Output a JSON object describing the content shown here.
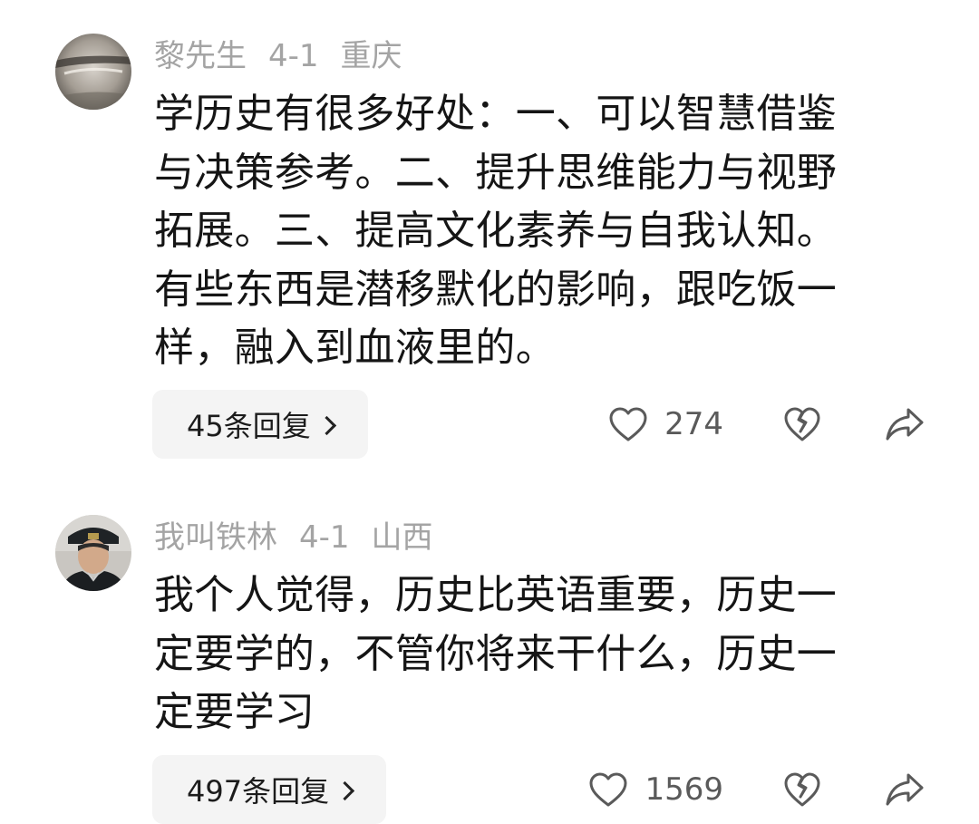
{
  "comments": [
    {
      "author": "黎先生",
      "date": "4-1",
      "location": "重庆",
      "text": "学历史有很多好处：一、可以智慧借鉴\n与决策参考。二、提升思维能力与视野\n拓展。三、提高文化素养与自我认知。\n有些东西是潜移默化的影响，跟吃饭一\n样，融入到血液里的。",
      "replies_label": "45条回复",
      "likes": "274",
      "icons": {
        "like": "heart-outline-icon",
        "dislike": "broken-heart-icon",
        "share": "share-arrow-icon",
        "expand": "chevron-right-icon"
      }
    },
    {
      "author": "我叫铁林",
      "date": "4-1",
      "location": "山西",
      "text": "我个人觉得，历史比英语重要，历史一\n定要学的，不管你将来干什么，历史一\n定要学习",
      "replies_label": "497条回复",
      "likes": "1569",
      "icons": {
        "like": "heart-outline-icon",
        "dislike": "broken-heart-icon",
        "share": "share-arrow-icon",
        "expand": "chevron-right-icon"
      }
    }
  ],
  "colors": {
    "meta_text": "#a4a4a4",
    "body_text": "#151515",
    "reply_bg": "#f4f4f4",
    "icon": "#5a5a5a"
  }
}
